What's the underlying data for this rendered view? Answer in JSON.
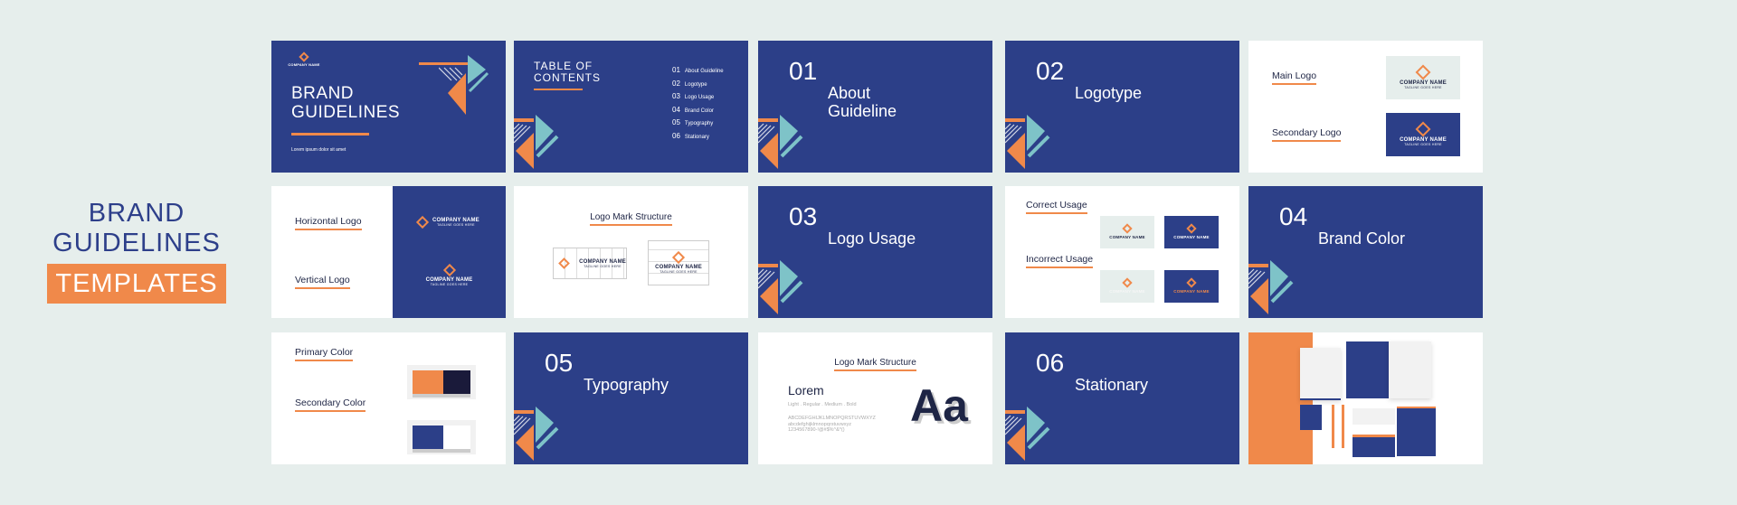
{
  "hero": {
    "line1": "BRAND",
    "line2": "GUIDELINES",
    "badge": "TEMPLATES"
  },
  "colors": {
    "navy": "#2c3f88",
    "orange": "#f0894a",
    "teal": "#7ec3c8",
    "dark": "#1a1a3a",
    "bg": "#e6eeec"
  },
  "company": {
    "name": "COMPANY NAME",
    "tagline": "TAGLINE GOES HERE"
  },
  "cover": {
    "line1": "BRAND",
    "line2": "GUIDELINES",
    "subtitle": "Lorem ipsum dolor sit amet"
  },
  "toc": {
    "title1": "TABLE OF",
    "title2": "CONTENTS",
    "items": [
      {
        "n": "01",
        "label": "About Guideline"
      },
      {
        "n": "02",
        "label": "Logotype"
      },
      {
        "n": "03",
        "label": "Logo Usage"
      },
      {
        "n": "04",
        "label": "Brand Color"
      },
      {
        "n": "05",
        "label": "Typography"
      },
      {
        "n": "06",
        "label": "Stationary"
      }
    ]
  },
  "sections": [
    {
      "n": "01",
      "l1": "About",
      "l2": "Guideline"
    },
    {
      "n": "02",
      "l1": "Logotype",
      "l2": ""
    },
    {
      "n": "03",
      "l1": "Logo Usage",
      "l2": ""
    },
    {
      "n": "04",
      "l1": "Brand Color",
      "l2": ""
    },
    {
      "n": "05",
      "l1": "Typography",
      "l2": ""
    },
    {
      "n": "06",
      "l1": "Stationary",
      "l2": ""
    }
  ],
  "logos": {
    "main": "Main Logo",
    "secondary": "Secondary Logo",
    "horizontal": "Horizontal Logo",
    "vertical": "Vertical Logo"
  },
  "structure": {
    "title": "Logo Mark Structure"
  },
  "usage": {
    "correct": "Correct Usage",
    "incorrect": "Incorrect Usage"
  },
  "color_slide": {
    "primary": "Primary Color",
    "secondary": "Secondary Color"
  },
  "typography": {
    "title": "Logo Mark Structure",
    "sample": "Lorem",
    "weights": "Light . Regular . Medium . Bold",
    "upper": "ABCDEFGHIJKLMNOPQRSTUVWXYZ",
    "lower": "abcdefghijklmnopqrstuvwxyz",
    "digits": "1234567890-!@#$%^&*()",
    "glyph": "Aa"
  }
}
